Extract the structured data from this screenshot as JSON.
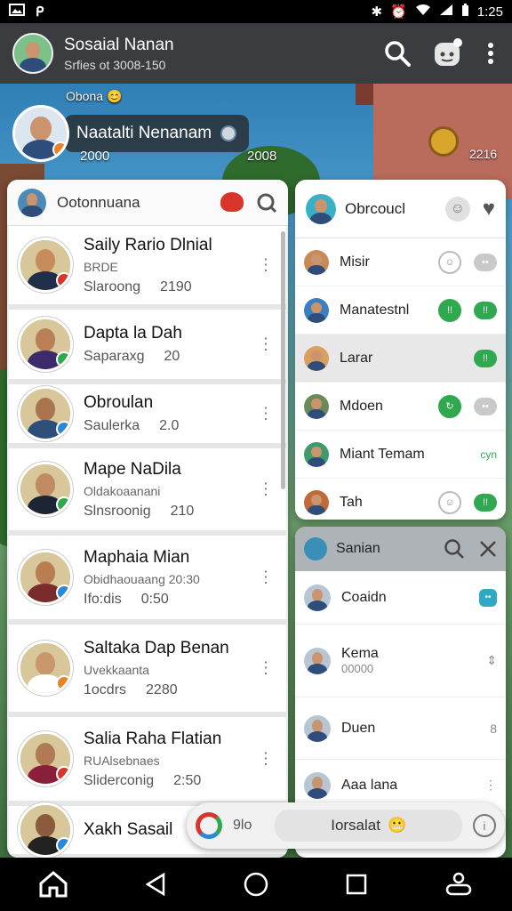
{
  "status": {
    "time": "1:25"
  },
  "appbar": {
    "title": "Sosaial Nanan",
    "subtitle": "Srfies ot 3008-150"
  },
  "hero": {
    "label": "Obona",
    "name": "Naatalti Nenanam",
    "num1": "2000",
    "num2": "2008",
    "num3": "2216"
  },
  "left_panel": {
    "title": "Ootonnuana",
    "contacts": [
      {
        "name": "Saily Rario Dlnial",
        "sub": "BRDE",
        "status": "Slaroong",
        "count": "2190",
        "badge": "#d9342b",
        "skin": "#c68c5a",
        "shirt": "#1f2f4a"
      },
      {
        "name": "Dapta la Dah",
        "sub": "",
        "status": "Saparaxg",
        "count": "20",
        "badge": "#2fa84f",
        "skin": "#b98058",
        "shirt": "#3d2a6b"
      },
      {
        "name": "Obroulan",
        "sub": "",
        "status": "Saulerka",
        "count": "2.0",
        "badge": "#2b88d9",
        "skin": "#a9744e",
        "shirt": "#2e4f7a"
      },
      {
        "name": "Mape NaDila",
        "sub": "Oldakoaanani",
        "status": "Slnsroonig",
        "count": "210",
        "badge": "#2fa84f",
        "skin": "#c08a62",
        "shirt": "#1b2533"
      },
      {
        "name": "Maphaia Mian",
        "sub": "Obidhaouaang 20:30",
        "status": "Ifo:dis",
        "count": "0:50",
        "badge": "#2b88d9",
        "skin": "#b97d52",
        "shirt": "#7a2c2c"
      },
      {
        "name": "Saltaka Dap Benan",
        "sub": "Uvekkaanta",
        "status": "1ocdrs",
        "count": "2280",
        "badge": "#e8832a",
        "skin": "#c9966e",
        "shirt": "#ffffff"
      },
      {
        "name": "Salia Raha Flatian",
        "sub": "RUAlsebnaes",
        "status": "Sliderconig",
        "count": "2:50",
        "badge": "#d9342b",
        "skin": "#b07a55",
        "shirt": "#8a1f3a"
      },
      {
        "name": "Xakh Sasail",
        "sub": "",
        "status": "",
        "count": "",
        "badge": "#2b88d9",
        "skin": "#8a5b3c",
        "shirt": "#222"
      }
    ]
  },
  "right_panel": {
    "title": "Obrcoucl",
    "rows": [
      {
        "name": "Misir",
        "a": "☺",
        "b": "••"
      },
      {
        "name": "Manatestnl",
        "a": "!!",
        "b": "!!"
      },
      {
        "name": "Larar",
        "a": "",
        "b": "!!"
      },
      {
        "name": "Mdoen",
        "a": "↻",
        "b": "••"
      },
      {
        "name": "Miant Temam",
        "a": "",
        "b": "cyn"
      },
      {
        "name": "Tah",
        "a": "☺",
        "b": "!!"
      }
    ]
  },
  "search_panel": {
    "title": "Sanian",
    "rows": [
      {
        "name": "Coaidn",
        "sub": ""
      },
      {
        "name": "Kema",
        "sub": "00000"
      },
      {
        "name": "Duen",
        "sub": ""
      },
      {
        "name": "Aaa lana",
        "sub": ""
      }
    ]
  },
  "composer": {
    "placeholder": "9lo",
    "field_text": "Iorsalat"
  }
}
